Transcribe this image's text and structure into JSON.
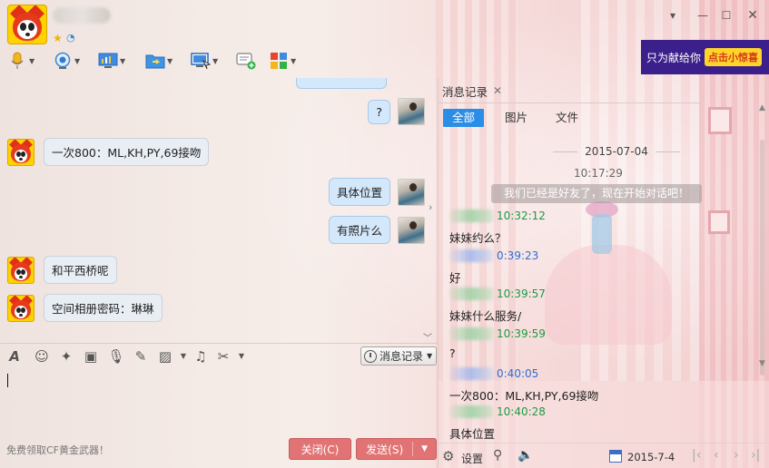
{
  "toolbar": {
    "icons": [
      "microphone-icon",
      "camera-icon",
      "screen-share-icon",
      "file-transfer-icon",
      "remote-desktop-icon",
      "message-add-icon",
      "apps-icon"
    ]
  },
  "ad": {
    "text": "只为献给你",
    "button": "点击小惊喜"
  },
  "chat": {
    "messages": [
      {
        "side": "right",
        "text": "?"
      },
      {
        "side": "left",
        "text": "一次800：ML,KH,PY,69接吻"
      },
      {
        "side": "right",
        "text": "具体位置"
      },
      {
        "side": "right",
        "text": "有照片么"
      },
      {
        "side": "left",
        "text": "和平西桥呢"
      },
      {
        "side": "left",
        "text": "空间相册密码：琳琳"
      }
    ]
  },
  "input": {
    "history_button": "消息记录",
    "promo": "免费领取CF黄金武器！",
    "close_label": "关闭(C)",
    "send_label": "发送(S)"
  },
  "history": {
    "tab_label": "消息记录",
    "filters": [
      "全部",
      "图片",
      "文件"
    ],
    "date": "2015-07-04",
    "first_time": "10:17:29",
    "system_message": "我们已经是好友了，现在开始对话吧！",
    "entries": [
      {
        "color": "green",
        "time": "10:32:12",
        "text": "妹妹约么？"
      },
      {
        "color": "blue",
        "time": "0:39:23",
        "text": "好"
      },
      {
        "color": "green",
        "time": "10:39:57",
        "text": "妹妹什么服务/"
      },
      {
        "color": "green",
        "time": "10:39:59",
        "text": "?"
      },
      {
        "color": "blue",
        "time": "0:40:05",
        "text": "一次800：ML,KH,PY,69接吻"
      },
      {
        "color": "green",
        "time": "10:40:28",
        "text": "具体位置"
      }
    ],
    "settings_label": "设置",
    "bottom_date": "2015-7-4"
  },
  "colors": {
    "accent": "#2b8ee6",
    "send_button": "#e27374",
    "green_time": "#1c9a43",
    "blue_time": "#2a6fd6"
  }
}
